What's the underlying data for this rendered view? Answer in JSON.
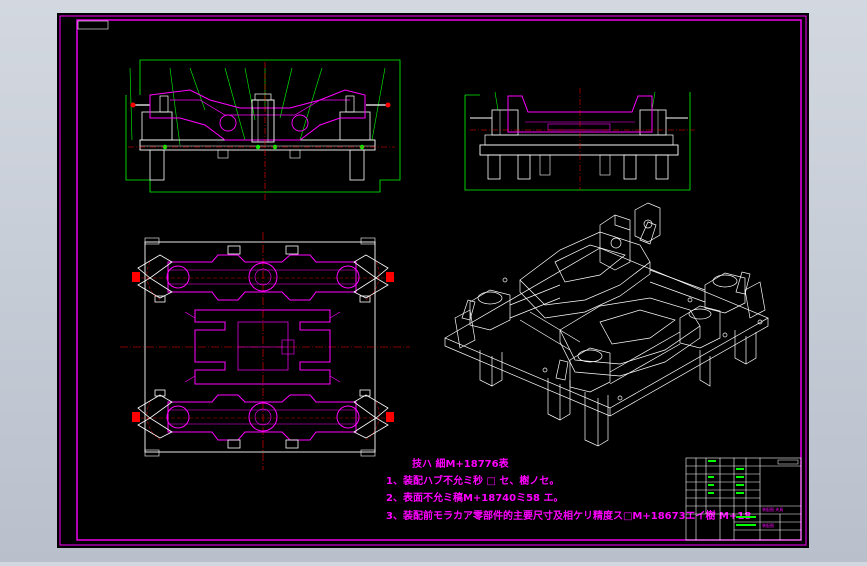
{
  "drawing": {
    "background": "#000000",
    "frame_color": "#ff00ff",
    "line_color": "#ffffff",
    "part_color": "#ff00ff",
    "dimension_color": "#00ff00",
    "centerline_color": "#ff0000"
  },
  "notes": {
    "title": "技ハ 細M+18776表",
    "lines": [
      "1、装配ハブ不允ミ秒 □ セ、樹ノセ。",
      "2、表面不允ミ稿M+18740ミ58 エ。",
      "3、装配前モラカア零部件的主要尺寸及相ケリ精度ス□M+18673エイ樹 M+18"
    ]
  },
  "title_block": {
    "company": "装配图 夹具",
    "sheet": "装配图"
  }
}
